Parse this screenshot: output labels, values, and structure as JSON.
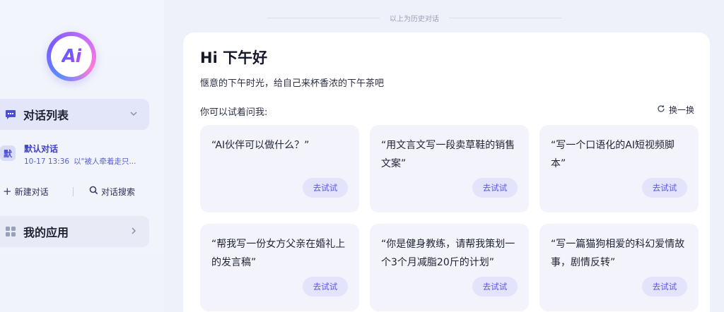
{
  "sidebar": {
    "logo_text": "Ai",
    "conversation_list_label": "对话列表",
    "conversation": {
      "avatar": "默",
      "title": "默认对话",
      "time": "10-17 13:36",
      "preview": "以\"被人牵着走只..."
    },
    "new_chat_label": "新建对话",
    "search_label": "对话搜索",
    "my_apps_label": "我的应用"
  },
  "main": {
    "history_label": "以上为历史对话",
    "greeting": "Hi 下午好",
    "subtitle": "惬意的下午时光，给自己来杯香浓的下午茶吧",
    "try_label": "你可以试着问我:",
    "refresh_label": "换一换",
    "questions": [
      {
        "text": "“AI伙伴可以做什么？”",
        "button": "去试试"
      },
      {
        "text": "“用文言文写一段卖草鞋的销售文案”",
        "button": "去试试"
      },
      {
        "text": "“写一个口语化的AI短视频脚本”",
        "button": "去试试"
      },
      {
        "text": "“帮我写一份女方父亲在婚礼上的发言稿”",
        "button": "去试试"
      },
      {
        "text": "“你是健身教练，请帮我策划一个3个月减脂20斤的计划”",
        "button": "去试试"
      },
      {
        "text": "“写一篇猫狗相爱的科幻爱情故事，剧情反转”",
        "button": "去试试"
      }
    ]
  },
  "colors": {
    "accent": "#5e55e6",
    "active_bg": "#e3e6f8",
    "card_bg": "#f3f4fb"
  },
  "icons": {
    "chat_list": "chat-bubble-icon",
    "chevron_down": "chevron-down-icon",
    "chevron_right": "chevron-right-icon",
    "apps": "grid-icon",
    "plus": "plus-icon",
    "search": "search-icon",
    "refresh": "refresh-icon"
  }
}
